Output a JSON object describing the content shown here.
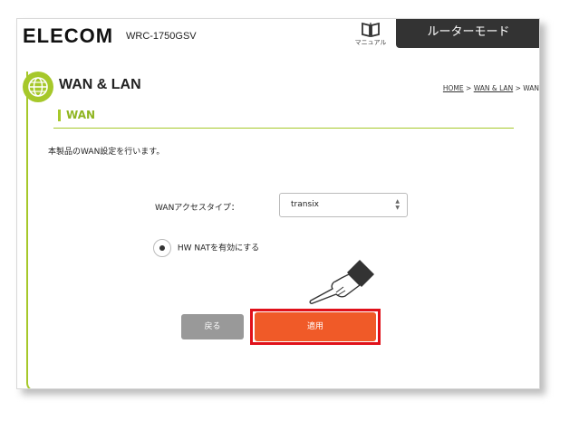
{
  "header": {
    "brand": "ELECOM",
    "model": "WRC-1750GSV",
    "manual_label": "マニュアル",
    "mode_label": "ルーターモード"
  },
  "page": {
    "title": "WAN & LAN",
    "breadcrumb": {
      "home": "HOME",
      "sep1": " > ",
      "wanlan": "WAN & LAN",
      "sep2": " > ",
      "current": "WAN"
    },
    "section_title": "WAN",
    "description": "本製品のWAN設定を行います。"
  },
  "form": {
    "wan_type_label": "WANアクセスタイプ：",
    "wan_type_value": "transix",
    "hw_nat_label": "HW NATを有効にする"
  },
  "buttons": {
    "back": "戻る",
    "apply": "適用"
  },
  "colors": {
    "accent": "#a6c82a",
    "apply": "#f05a28",
    "highlight": "#e0101a",
    "mode_bg": "#333333"
  }
}
